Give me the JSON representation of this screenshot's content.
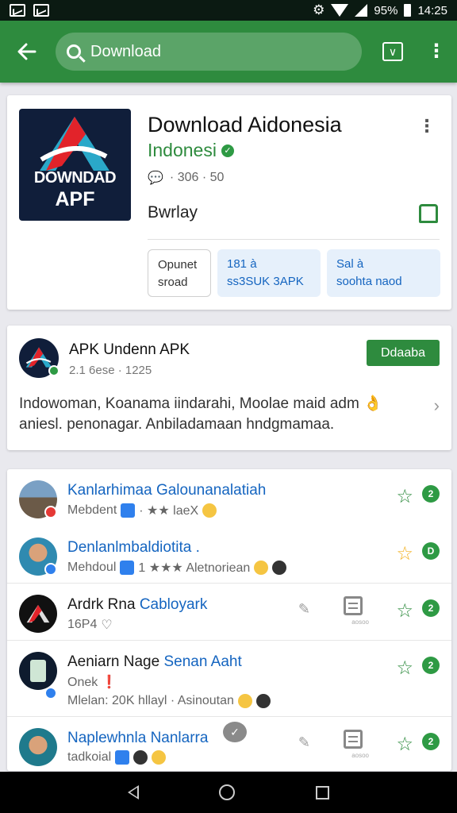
{
  "status_bar": {
    "battery": "95%",
    "time": "14:25"
  },
  "app_bar": {
    "search_text": "Download"
  },
  "app_card": {
    "icon_text_line1": "DOWNDAD",
    "icon_text_line2": "APF",
    "title": "Download Aidonesia",
    "developer": "Indonesi",
    "meta": "· 306 · 50",
    "category": "Bwrlay",
    "chips": [
      {
        "line1": "Opunet",
        "line2": "sroad"
      },
      {
        "line1": "181 à",
        "line2": "ss3SUK 3APK"
      },
      {
        "line1": "Sal à",
        "line2": "soohta   naod"
      }
    ]
  },
  "post_card": {
    "title": "APK Undenn APK",
    "subtitle": "2.1 6ese · 1225",
    "action": "Ddaaba",
    "body": "Indowoman, Koanama iindarahi, Moolae maid adm 👌 aniesl. penonagar. Anbiladamaan hndgmamaa."
  },
  "list": {
    "rows": [
      {
        "title_a": "",
        "title_b": "Kanlarhimaa Galounanalatiah",
        "sub": "Mebdent",
        "sub2": "· ★★ laeX",
        "count": "2",
        "star_gold": false
      },
      {
        "title_a": "",
        "title_b": "Denlanlmbaldiotita .",
        "sub": "Mehdoul",
        "sub2": "1 ★★★ Aletnoriean",
        "count": "D",
        "star_gold": true
      },
      {
        "title_a": "Ardrk Rna ",
        "title_b": "Cabloyark",
        "sub": "16P4",
        "sub2": "",
        "count": "2",
        "star_gold": false,
        "doc_label": "aosoo"
      },
      {
        "title_a": "Aeniarn Nage ",
        "title_b": "Senan Aaht",
        "sub": "Onek ❗",
        "sub2": "Mlelan: 20K hllayl · Asinoutan",
        "count": "2",
        "star_gold": false
      },
      {
        "title_a": "",
        "title_b": "Naplewhnla Nanlarra",
        "sub": "tadkoial",
        "sub2": "",
        "count": "2",
        "star_gold": false,
        "doc_label": "aosoo"
      }
    ]
  },
  "colors": {
    "primary": "#2e8b3e",
    "link": "#1565c0",
    "badge": "#2e9a44"
  }
}
